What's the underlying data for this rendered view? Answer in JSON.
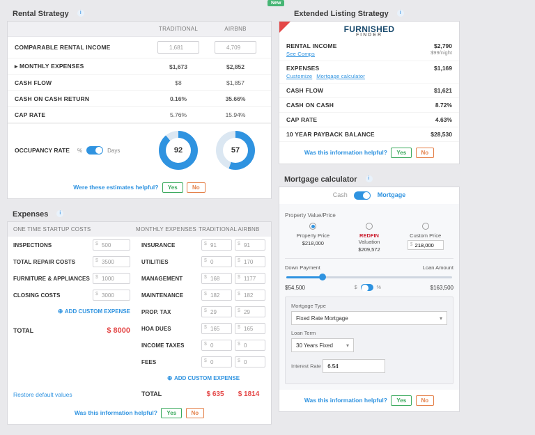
{
  "rental_strategy": {
    "title": "Rental Strategy",
    "head_trad": "TRADITIONAL",
    "head_airbnb": "AIRBNB",
    "rows": {
      "comparable_income": {
        "label": "COMPARABLE RENTAL INCOME",
        "trad": "1,681",
        "airbnb": "4,709"
      },
      "monthly_expenses": {
        "label": "▸ MONTHLY EXPENSES",
        "trad": "$1,673",
        "airbnb": "$2,852"
      },
      "cash_flow": {
        "label": "CASH FLOW",
        "trad": "$8",
        "airbnb": "$1,857"
      },
      "cocr": {
        "label": "CASH ON CASH RETURN",
        "trad": "0.16%",
        "airbnb": "35.66%"
      },
      "cap_rate": {
        "label": "CAP RATE",
        "trad": "5.76%",
        "airbnb": "15.94%"
      }
    },
    "occupancy": {
      "label": "OCCUPANCY RATE",
      "pct_label": "%",
      "days_label": "Days",
      "trad": "92",
      "airbnb": "57"
    },
    "helpful": {
      "text": "Were these estimates helpful?",
      "yes": "Yes",
      "no": "No"
    }
  },
  "extended": {
    "new": "New",
    "title": "Extended Listing Strategy",
    "brand": "FURNISHED",
    "brand_sub": "FINDER",
    "rows": {
      "rental_income": {
        "label": "RENTAL INCOME",
        "sub": "See Comps",
        "val": "$2,790",
        "sub_val": "$99/night"
      },
      "expenses": {
        "label": "EXPENSES",
        "sub_customize": "Customize",
        "sub_calc": "Mortgage calculator",
        "val": "$1,169"
      },
      "cash_flow": {
        "label": "CASH FLOW",
        "val": "$1,621"
      },
      "coc": {
        "label": "CASH ON CASH",
        "val": "8.72%"
      },
      "cap_rate": {
        "label": "CAP RATE",
        "val": "4.63%"
      },
      "payback": {
        "label": "10 YEAR PAYBACK BALANCE",
        "val": "$28,530"
      }
    },
    "helpful": {
      "text": "Was this information helpful?",
      "yes": "Yes",
      "no": "No"
    }
  },
  "expenses": {
    "title": "Expenses",
    "head_one_time": "ONE TIME STARTUP COSTS",
    "head_monthly": "MONTHLY EXPENSES",
    "head_trad": "TRADITIONAL",
    "head_airbnb": "AIRBNB",
    "one_time": {
      "inspections": {
        "label": "INSPECTIONS",
        "val": "500"
      },
      "repair": {
        "label": "TOTAL REPAIR COSTS",
        "val": "3500"
      },
      "furniture": {
        "label": "FURNITURE & APPLIANCES",
        "val": "1000"
      },
      "closing": {
        "label": "CLOSING COSTS",
        "val": "3000"
      }
    },
    "add_custom": "ADD CUSTOM EXPENSE",
    "total_label": "TOTAL",
    "one_time_total": "$ 8000",
    "monthly": {
      "insurance": {
        "label": "INSURANCE",
        "trad": "91",
        "airbnb": "91"
      },
      "utilities": {
        "label": "UTILITIES",
        "trad": "0",
        "airbnb": "170"
      },
      "management": {
        "label": "MANAGEMENT",
        "trad": "168",
        "airbnb": "1177"
      },
      "maintenance": {
        "label": "MAINTENANCE",
        "trad": "182",
        "airbnb": "182"
      },
      "prop_tax": {
        "label": "PROP. TAX",
        "trad": "29",
        "airbnb": "29"
      },
      "hoa": {
        "label": "HOA DUES",
        "trad": "165",
        "airbnb": "165"
      },
      "income_tax": {
        "label": "INCOME TAXES",
        "trad": "0",
        "airbnb": "0"
      },
      "fees": {
        "label": "FEES",
        "trad": "0",
        "airbnb": "0"
      }
    },
    "monthly_total_trad": "$ 635",
    "monthly_total_airbnb": "$ 1814",
    "restore": "Restore default values",
    "helpful": {
      "text": "Was this information helpful?",
      "yes": "Yes",
      "no": "No"
    }
  },
  "mortgage": {
    "title": "Mortgage calculator",
    "toggle_cash": "Cash",
    "toggle_mortgage": "Mortgage",
    "price_label": "Property Value/Price",
    "cols": {
      "property": {
        "label": "Property Price",
        "val": "$218,000"
      },
      "redfin": {
        "brand": "REDFIN",
        "label": "Valuation",
        "val": "$209,572"
      },
      "custom": {
        "label": "Custom Price",
        "val": "218,000"
      }
    },
    "down_payment_label": "Down Payment",
    "loan_amount_label": "Loan Amount",
    "down_payment_val": "$54,500",
    "dp_toggle_dollar": "$",
    "dp_toggle_pct": "%",
    "loan_amount_val": "$163,500",
    "mortgage_type_label": "Mortgage Type",
    "mortgage_type_val": "Fixed Rate Mortgage",
    "loan_term_label": "Loan Term",
    "loan_term_val": "30 Years Fixed",
    "interest_label": "Interest Rate",
    "interest_val": "6.54",
    "helpful": {
      "text": "Was this information helpful?",
      "yes": "Yes",
      "no": "No"
    }
  }
}
